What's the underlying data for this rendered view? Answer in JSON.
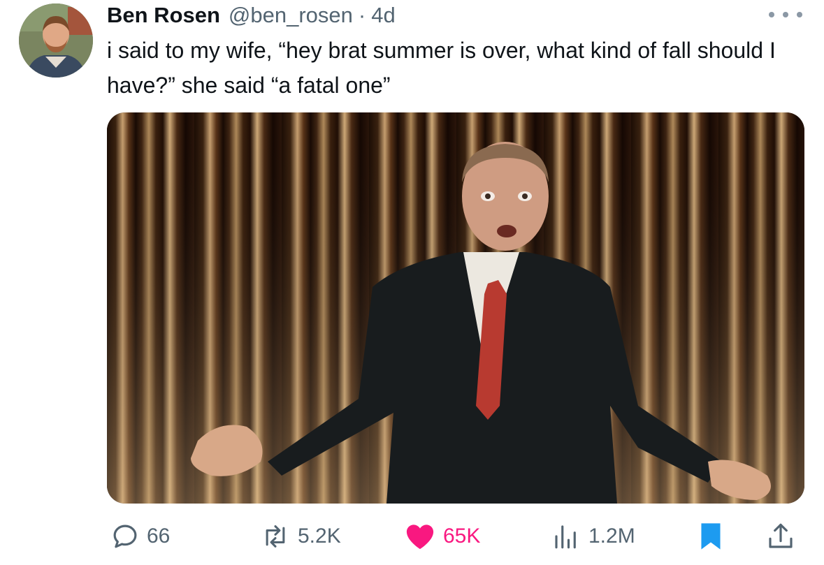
{
  "tweet": {
    "author_name": "Ben Rosen",
    "handle": "@ben_rosen",
    "separator": "·",
    "time": "4d",
    "text": "i said to my wife, “hey brat summer is over, what kind of fall should I have?” she said “a fatal one”"
  },
  "actions": {
    "replies": "66",
    "retweets": "5.2K",
    "likes": "65K",
    "views": "1.2M"
  },
  "colors": {
    "like": "#f91880",
    "bookmark": "#1d9bf0",
    "muted": "#536471"
  },
  "icons": [
    "more-icon",
    "reply-icon",
    "retweet-icon",
    "heart-icon",
    "views-icon",
    "bookmark-icon",
    "share-icon"
  ]
}
